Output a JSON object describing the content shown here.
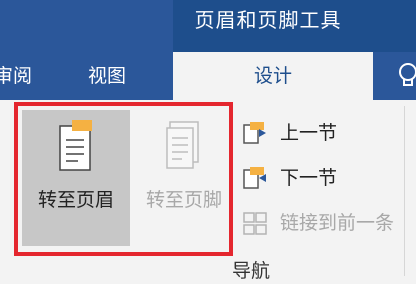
{
  "tabs": {
    "contextual_title": "页眉和页脚工具",
    "review": "审阅",
    "view": "视图",
    "design": "设计"
  },
  "ribbon": {
    "go_to_header": "转至页眉",
    "go_to_footer": "转至页脚",
    "previous_section": "上一节",
    "next_section": "下一节",
    "link_to_previous": "链接到前一条",
    "group_label": "导航"
  },
  "icons": {
    "tellme": "lightbulb-icon",
    "header": "page-header-icon",
    "footer": "page-footer-icon",
    "previous": "previous-section-icon",
    "next": "next-section-icon",
    "link": "link-icon"
  },
  "colors": {
    "tab_bar": "#2b579a",
    "contextual_header": "#1e4e8c",
    "highlight": "#e4262e",
    "pressed": "#c7c7c7",
    "accent": "#f5b142"
  }
}
